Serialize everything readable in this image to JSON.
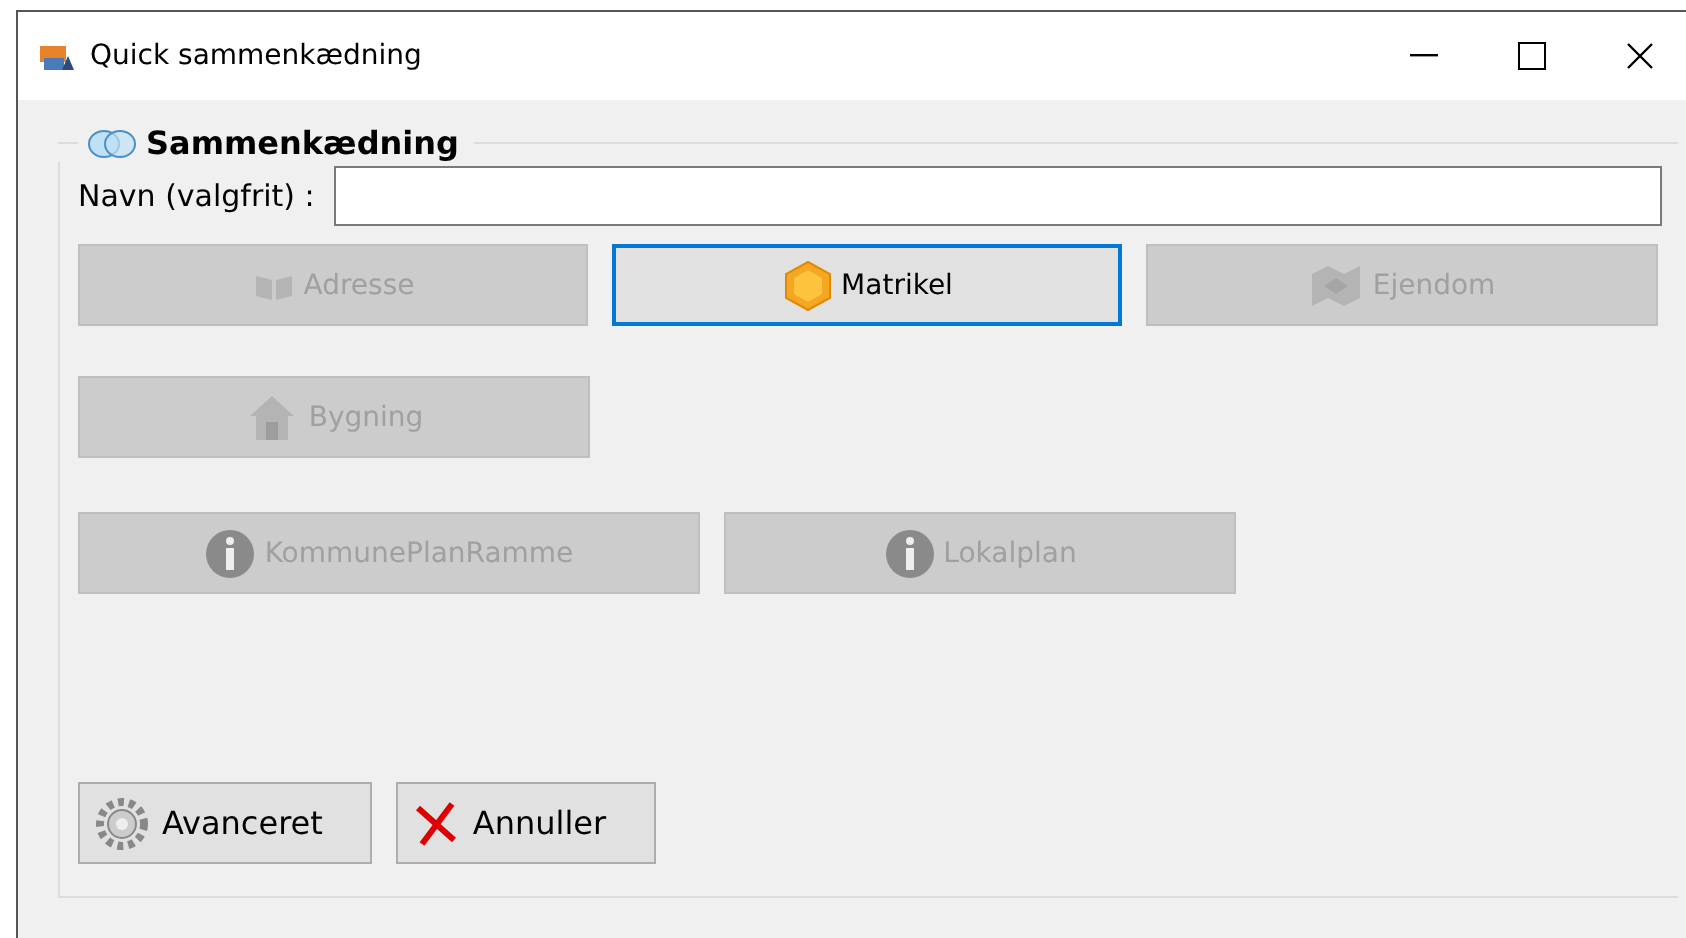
{
  "window": {
    "title": "Quick sammenkædning"
  },
  "group": {
    "title": "Sammenkædning"
  },
  "name_field": {
    "label": "Navn (valgfrit) :"
  },
  "layer_rows": [
    [
      {
        "label": "Adresse",
        "kind": "book",
        "disabled": true,
        "focused": false
      },
      {
        "label": "Matrikel",
        "kind": "hexagon",
        "disabled": false,
        "focused": true
      },
      {
        "label": "Ejendom",
        "kind": "map",
        "disabled": true,
        "focused": false
      }
    ],
    [
      {
        "label": "Bygning",
        "kind": "house",
        "disabled": true,
        "focused": false
      }
    ],
    [
      {
        "label": "KommunePlanRamme",
        "kind": "info",
        "disabled": true,
        "focused": false
      },
      {
        "label": "Lokalplan",
        "kind": "info",
        "disabled": true,
        "focused": false
      }
    ]
  ],
  "buttons": [
    {
      "label": "Avanceret",
      "kind": "gear"
    },
    {
      "label": "Annuller",
      "kind": "cross"
    }
  ]
}
